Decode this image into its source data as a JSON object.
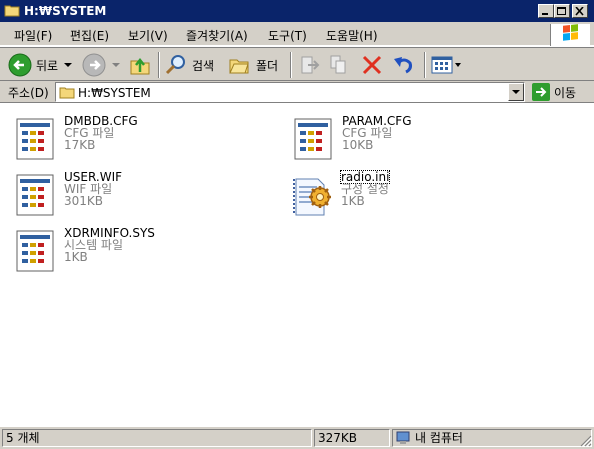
{
  "window": {
    "title": "H:₩SYSTEM"
  },
  "menu": [
    {
      "label": "파일(F)"
    },
    {
      "label": "편집(E)"
    },
    {
      "label": "보기(V)"
    },
    {
      "label": "즐겨찾기(A)"
    },
    {
      "label": "도구(T)"
    },
    {
      "label": "도움말(H)"
    }
  ],
  "toolbar": {
    "back_label": "뒤로",
    "search_label": "검색",
    "folders_label": "폴더"
  },
  "address": {
    "label": "주소(D)",
    "value": "H:₩SYSTEM",
    "go_label": "이동"
  },
  "files": [
    {
      "name": "DMBDB.CFG",
      "type": "CFG 파일",
      "size": "17KB",
      "icon": "system-file-icon"
    },
    {
      "name": "PARAM.CFG",
      "type": "CFG 파일",
      "size": "10KB",
      "icon": "system-file-icon"
    },
    {
      "name": "USER.WIF",
      "type": "WIF 파일",
      "size": "301KB",
      "icon": "system-file-icon"
    },
    {
      "name": "radio.ini",
      "type": "구성 설정",
      "size": "1KB",
      "icon": "config-settings-icon"
    },
    {
      "name": "XDRMINFO.SYS",
      "type": "시스템 파일",
      "size": "1KB",
      "icon": "system-file-icon"
    }
  ],
  "status": {
    "count": "5 개체",
    "size": "327KB",
    "location": "내 컴퓨터"
  },
  "colors": {
    "titlebar": "#0a246a",
    "chrome": "#d4d0c8",
    "back_arrow": "#2e9d2e"
  }
}
